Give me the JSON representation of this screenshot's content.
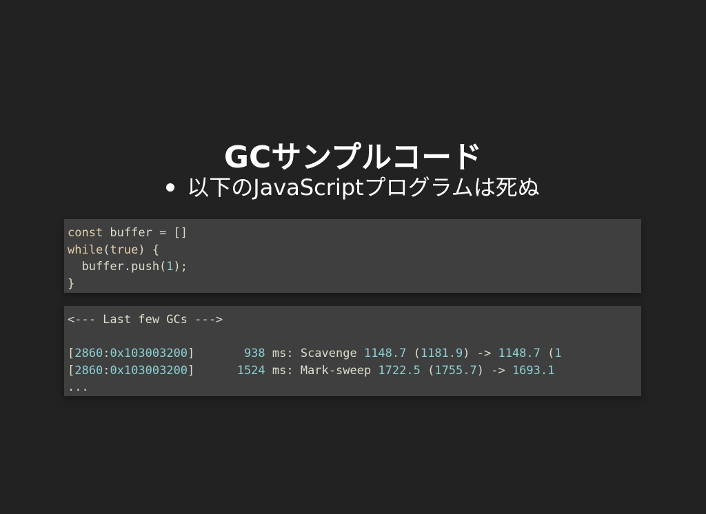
{
  "slide": {
    "title": "GCサンプルコード",
    "bullets": [
      {
        "text": "以下のJavaScriptプログラムは死ぬ"
      }
    ]
  },
  "code_blocks": [
    {
      "lines": [
        [
          {
            "t": "const",
            "c": "kw"
          },
          {
            "t": " buffer = []",
            "c": "punct"
          }
        ],
        [
          {
            "t": "while",
            "c": "kw"
          },
          {
            "t": "(",
            "c": "punct"
          },
          {
            "t": "true",
            "c": "kw"
          },
          {
            "t": ") {",
            "c": "punct"
          }
        ],
        [
          {
            "t": "  buffer.push(",
            "c": "punct"
          },
          {
            "t": "1",
            "c": "num"
          },
          {
            "t": ");",
            "c": "punct"
          }
        ],
        [
          {
            "t": "}",
            "c": "punct"
          }
        ]
      ]
    },
    {
      "lines": [
        [
          {
            "t": "<--- Last few GCs --->",
            "c": "punct"
          }
        ],
        [],
        [
          {
            "t": "[",
            "c": "punct"
          },
          {
            "t": "2860",
            "c": "num"
          },
          {
            "t": ":",
            "c": "punct"
          },
          {
            "t": "0x103003200",
            "c": "num"
          },
          {
            "t": "]       ",
            "c": "punct"
          },
          {
            "t": "938",
            "c": "num"
          },
          {
            "t": " ms: Scavenge ",
            "c": "punct"
          },
          {
            "t": "1148.7",
            "c": "num"
          },
          {
            "t": " (",
            "c": "punct"
          },
          {
            "t": "1181.9",
            "c": "num"
          },
          {
            "t": ") -> ",
            "c": "punct"
          },
          {
            "t": "1148.7",
            "c": "num"
          },
          {
            "t": " (",
            "c": "punct"
          },
          {
            "t": "1",
            "c": "num"
          }
        ],
        [
          {
            "t": "[",
            "c": "punct"
          },
          {
            "t": "2860",
            "c": "num"
          },
          {
            "t": ":",
            "c": "punct"
          },
          {
            "t": "0x103003200",
            "c": "num"
          },
          {
            "t": "]      ",
            "c": "punct"
          },
          {
            "t": "1524",
            "c": "num"
          },
          {
            "t": " ms: Mark-sweep ",
            "c": "punct"
          },
          {
            "t": "1722.5",
            "c": "num"
          },
          {
            "t": " (",
            "c": "punct"
          },
          {
            "t": "1755.7",
            "c": "num"
          },
          {
            "t": ") -> ",
            "c": "punct"
          },
          {
            "t": "1693.1",
            "c": "num"
          },
          {
            "t": " ",
            "c": "punct"
          }
        ],
        [
          {
            "t": "...",
            "c": "punct"
          }
        ]
      ]
    }
  ],
  "colors": {
    "background": "#222222",
    "code_background": "#3f3f3f",
    "keyword": "#e3ceab",
    "number": "#8cd0d3",
    "text": "#dcdccc"
  }
}
